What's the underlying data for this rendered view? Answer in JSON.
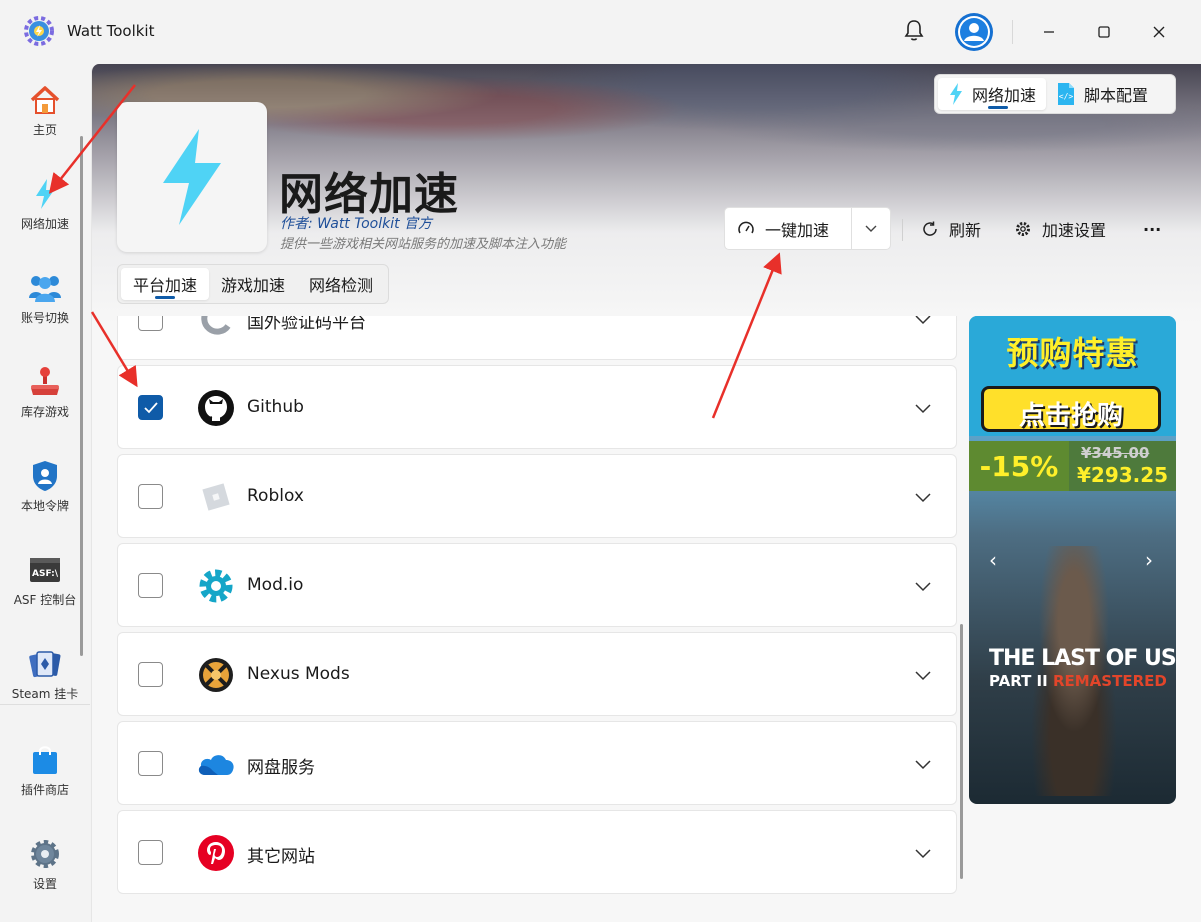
{
  "app": {
    "title": "Watt Toolkit"
  },
  "sidebar": {
    "items": [
      {
        "label": "主页",
        "icon": "home-icon"
      },
      {
        "label": "网络加速",
        "icon": "lightning-icon"
      },
      {
        "label": "账号切换",
        "icon": "users-icon"
      },
      {
        "label": "库存游戏",
        "icon": "joystick-icon"
      },
      {
        "label": "本地令牌",
        "icon": "shield-icon"
      },
      {
        "label": "ASF 控制台",
        "icon": "asf-icon"
      },
      {
        "label": "Steam 挂卡",
        "icon": "cards-icon"
      },
      {
        "label": "插件商店",
        "icon": "shopping-bag-icon"
      },
      {
        "label": "设置",
        "icon": "gear-icon"
      }
    ]
  },
  "header": {
    "segments": [
      {
        "label": "网络加速",
        "icon": "lightning-icon"
      },
      {
        "label": "脚本配置",
        "icon": "script-icon"
      }
    ],
    "title": "网络加速",
    "author": "作者: Watt Toolkit 官方",
    "description": "提供一些游戏相关网站服务的加速及脚本注入功能",
    "one_click": "一键加速",
    "refresh": "刷新",
    "settings": "加速设置",
    "more": "···"
  },
  "tabs": [
    {
      "label": "平台加速"
    },
    {
      "label": "游戏加速"
    },
    {
      "label": "网络检测"
    }
  ],
  "services": [
    {
      "name": "国外验证码平台",
      "checked": false,
      "icon": "captcha-icon"
    },
    {
      "name": "Github",
      "checked": true,
      "icon": "github-icon"
    },
    {
      "name": "Roblox",
      "checked": false,
      "icon": "roblox-icon"
    },
    {
      "name": "Mod.io",
      "checked": false,
      "icon": "modio-icon"
    },
    {
      "name": "Nexus Mods",
      "checked": false,
      "icon": "nexus-icon"
    },
    {
      "name": "网盘服务",
      "checked": false,
      "icon": "cloud-icon"
    },
    {
      "name": "其它网站",
      "checked": false,
      "icon": "pinterest-icon"
    }
  ],
  "ad": {
    "headline": "预购特惠",
    "cta": "点击抢购",
    "discount": "-15%",
    "old_price": "¥345.00",
    "new_price": "¥293.25",
    "game_line1": "THE LAST OF US",
    "game_line2a": "PART II",
    "game_line2b": "REMASTERED"
  },
  "colors": {
    "accent": "#0f5ba8",
    "lightning": "#4fd3f5",
    "annotation_arrow": "#e8302a"
  }
}
